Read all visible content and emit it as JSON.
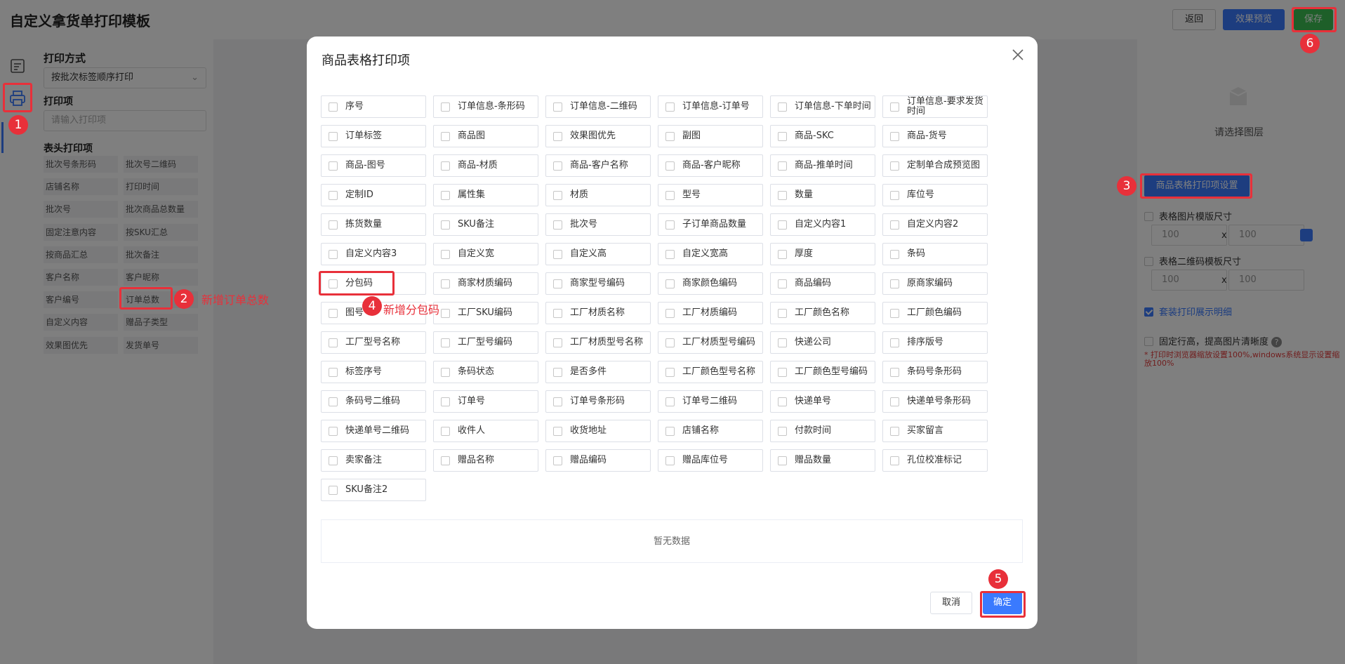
{
  "app": {
    "title": "自定义拿货单打印模板",
    "buttons": {
      "back": "返回",
      "preview": "效果预览",
      "save": "保存"
    }
  },
  "left_panel": {
    "print_mode_heading": "打印方式",
    "print_mode_value": "按批次标签顺序打印",
    "print_items_heading": "打印项",
    "print_items_placeholder": "请输入打印项",
    "header_items_heading": "表头打印项",
    "header_items": [
      "批次号条形码",
      "批次号二维码",
      "店铺名称",
      "打印时间",
      "批次号",
      "批次商品总数量",
      "固定注意内容",
      "按SKU汇总",
      "按商品汇总",
      "批次备注",
      "客户名称",
      "客户昵称",
      "客户编号",
      "订单总数",
      "自定义内容",
      "赠品子类型",
      "效果图优先",
      "发货单号"
    ]
  },
  "right_panel": {
    "select_layer": "请选择图层",
    "table_settings_button": "商品表格打印项设置",
    "image_size_label": "表格图片模版尺寸",
    "qr_size_label": "表格二维码模板尺寸",
    "image_w": "100",
    "image_h": "100",
    "qr_w": "100",
    "qr_h": "100",
    "x_sep": "x",
    "suite_detail_label": "套装打印展示明细",
    "fixed_row_label": "固定行高，提高图片清晰度",
    "help": "?",
    "warning": "* 打印时浏览器缩放设置100%,windows系统显示设置缩放100%",
    "accent": "#3a7afe"
  },
  "modal": {
    "title": "商品表格打印项",
    "options": [
      "序号",
      "订单信息-条形码",
      "订单信息-二维码",
      "订单信息-订单号",
      "订单信息-下单时间",
      "订单信息-要求发货时间",
      "订单标签",
      "商品图",
      "效果图优先",
      "副图",
      "商品-SKC",
      "商品-货号",
      "商品-图号",
      "商品-材质",
      "商品-客户名称",
      "商品-客户昵称",
      "商品-推单时间",
      "定制单合成预览图",
      "定制ID",
      "属性集",
      "材质",
      "型号",
      "数量",
      "库位号",
      "拣货数量",
      "SKU备注",
      "批次号",
      "子订单商品数量",
      "自定义内容1",
      "自定义内容2",
      "自定义内容3",
      "自定义宽",
      "自定义高",
      "自定义宽高",
      "厚度",
      "条码",
      "分包码",
      "商家材质编码",
      "商家型号编码",
      "商家颜色编码",
      "商品编码",
      "原商家编码",
      "图号",
      "工厂SKU编码",
      "工厂材质名称",
      "工厂材质编码",
      "工厂颜色名称",
      "工厂颜色编码",
      "工厂型号名称",
      "工厂型号编码",
      "工厂材质型号名称",
      "工厂材质型号编码",
      "快递公司",
      "排序版号",
      "标签序号",
      "条码状态",
      "是否多件",
      "工厂颜色型号名称",
      "工厂颜色型号编码",
      "条码号条形码",
      "条码号二维码",
      "订单号",
      "订单号条形码",
      "订单号二维码",
      "快递单号",
      "快递单号条形码",
      "快递单号二维码",
      "收件人",
      "收货地址",
      "店铺名称",
      "付款时间",
      "买家留言",
      "卖家备注",
      "赠品名称",
      "赠品编码",
      "赠品库位号",
      "赠品数量",
      "孔位校准标记",
      "SKU备注2"
    ],
    "empty_text": "暂无数据",
    "cancel": "取消",
    "ok": "确定"
  },
  "annotations": {
    "color": "#e8303a",
    "badges": [
      "1",
      "2",
      "3",
      "4",
      "5",
      "6"
    ],
    "note_order_total": "新增订单总数",
    "note_sub_package": "新增分包码"
  }
}
